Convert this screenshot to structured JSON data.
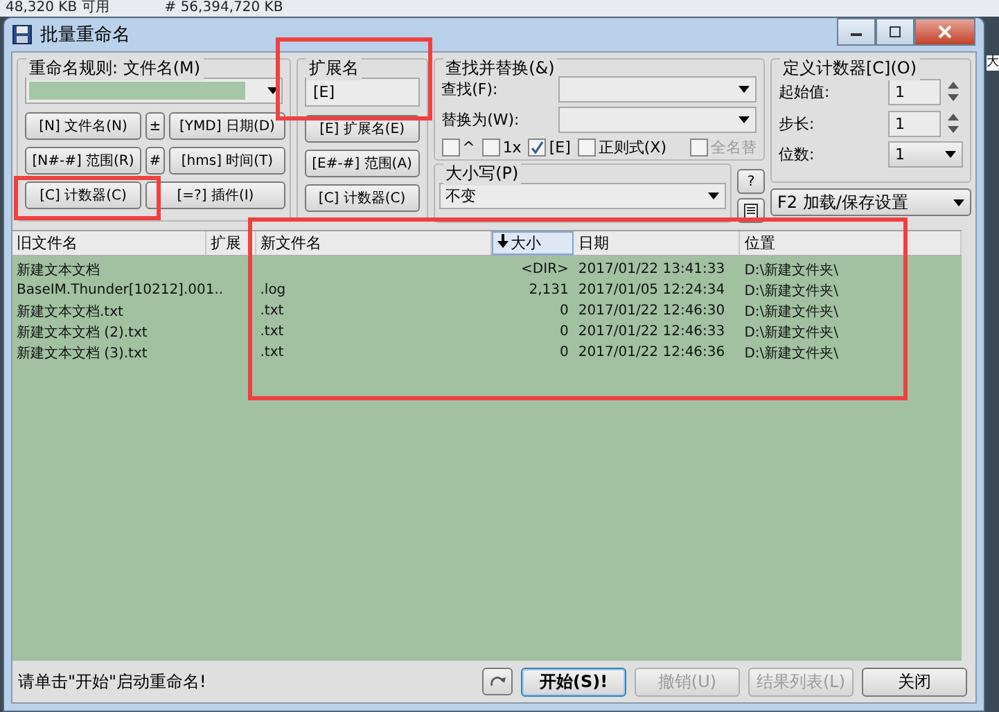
{
  "background": {
    "texts": [
      "48,320 KB 可用",
      "# 56,394,720 KB"
    ],
    "side_text": "大"
  },
  "window": {
    "title": "批量重命名"
  },
  "rename_mask": {
    "label": "重命名规则: 文件名(M)",
    "buttons": [
      {
        "label": "[N] 文件名(N)",
        "highlighted": false
      },
      {
        "label": "±",
        "highlighted": false
      },
      {
        "label": "[YMD] 日期(D)",
        "highlighted": false
      },
      {
        "label": "[N#-#] 范围(R)",
        "highlighted": false
      },
      {
        "label": "#",
        "highlighted": false
      },
      {
        "label": "[hms] 时间(T)",
        "highlighted": false
      },
      {
        "label": "[C] 计数器(C)",
        "highlighted": true
      },
      {
        "label": "[=?] 插件(I)",
        "highlighted": false
      }
    ]
  },
  "extension": {
    "label": "扩展名",
    "value": "[E]",
    "highlighted": true,
    "buttons": [
      {
        "label": "[E] 扩展名(E)"
      },
      {
        "label": "[E#-#] 范围(A)"
      },
      {
        "label": "[C] 计数器(C)"
      }
    ]
  },
  "find_replace": {
    "label": "查找并替换(&)",
    "find_label": "查找(F):",
    "replace_label": "替换为(W):",
    "options": [
      {
        "label": "^",
        "checked": false,
        "disabled": false
      },
      {
        "label": "1x",
        "checked": false,
        "disabled": false
      },
      {
        "label": "[E]",
        "checked": true,
        "disabled": false
      },
      {
        "label": "正则式(X)",
        "checked": false,
        "disabled": false
      },
      {
        "label": "全名替",
        "checked": false,
        "disabled": true
      }
    ]
  },
  "case": {
    "label": "大小写(P)",
    "value": "不变"
  },
  "help_button": "?",
  "counter": {
    "label": "定义计数器[C](O)",
    "start_label": "起始值:",
    "start_value": "1",
    "step_label": "步长:",
    "step_value": "1",
    "digits_label": "位数:",
    "digits_value": "1"
  },
  "settings_dropdown": "F2 加载/保存设置",
  "file_list": {
    "highlighted": true,
    "columns": [
      {
        "label": "旧文件名"
      },
      {
        "label": "扩展"
      },
      {
        "label": "新文件名"
      },
      {
        "label": "大小",
        "sorted": true
      },
      {
        "label": "日期"
      },
      {
        "label": "位置"
      }
    ],
    "rows": [
      {
        "old_name": "新建文本文档",
        "new_name": "",
        "size": "<DIR>",
        "date": "2017/01/22 13:41:33",
        "location": "D:\\新建文件夹\\"
      },
      {
        "old_name": "BaseIM.Thunder[10212].001..",
        "new_name": ".log",
        "size": "2,131",
        "date": "2017/01/05 12:24:34",
        "location": "D:\\新建文件夹\\"
      },
      {
        "old_name": "新建文本文档.txt",
        "new_name": ".txt",
        "size": "0",
        "date": "2017/01/22 12:46:30",
        "location": "D:\\新建文件夹\\"
      },
      {
        "old_name": "新建文本文档 (2).txt",
        "new_name": ".txt",
        "size": "0",
        "date": "2017/01/22 12:46:33",
        "location": "D:\\新建文件夹\\"
      },
      {
        "old_name": "新建文本文档 (3).txt",
        "new_name": ".txt",
        "size": "0",
        "date": "2017/01/22 12:46:36",
        "location": "D:\\新建文件夹\\"
      }
    ]
  },
  "status_bar": {
    "message": "请单击\"开始\"启动重命名!",
    "buttons": [
      {
        "label": "开始(S)!",
        "kind": "default",
        "disabled": false
      },
      {
        "label": "撤销(U)",
        "kind": "normal",
        "disabled": true
      },
      {
        "label": "结果列表(L)",
        "kind": "normal",
        "disabled": true
      },
      {
        "label": "关闭",
        "kind": "normal",
        "disabled": false
      }
    ]
  }
}
